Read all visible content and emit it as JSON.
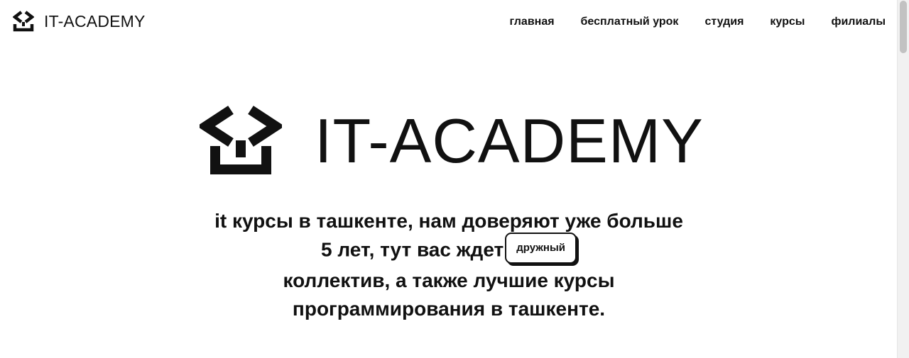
{
  "header": {
    "brand": "IT-ACADEMY",
    "logo_icon": "graduation-cap-code-icon",
    "nav": [
      {
        "label": "главная"
      },
      {
        "label": "бесплатный урок"
      },
      {
        "label": "студия"
      },
      {
        "label": "курсы"
      },
      {
        "label": "филиалы"
      }
    ]
  },
  "hero": {
    "brand": "IT-ACADEMY",
    "lines": [
      "it курсы в ташкенте, нам доверяют уже больше",
      "5 лет, тут вас ждет",
      "коллектив, а также лучшие курсы",
      "программирования в ташкенте."
    ],
    "highlight_word": "дружный"
  },
  "colors": {
    "text": "#111111",
    "background": "#ffffff",
    "scrollbar_track": "#f1f1f1",
    "scrollbar_thumb": "#c2c2c2"
  }
}
